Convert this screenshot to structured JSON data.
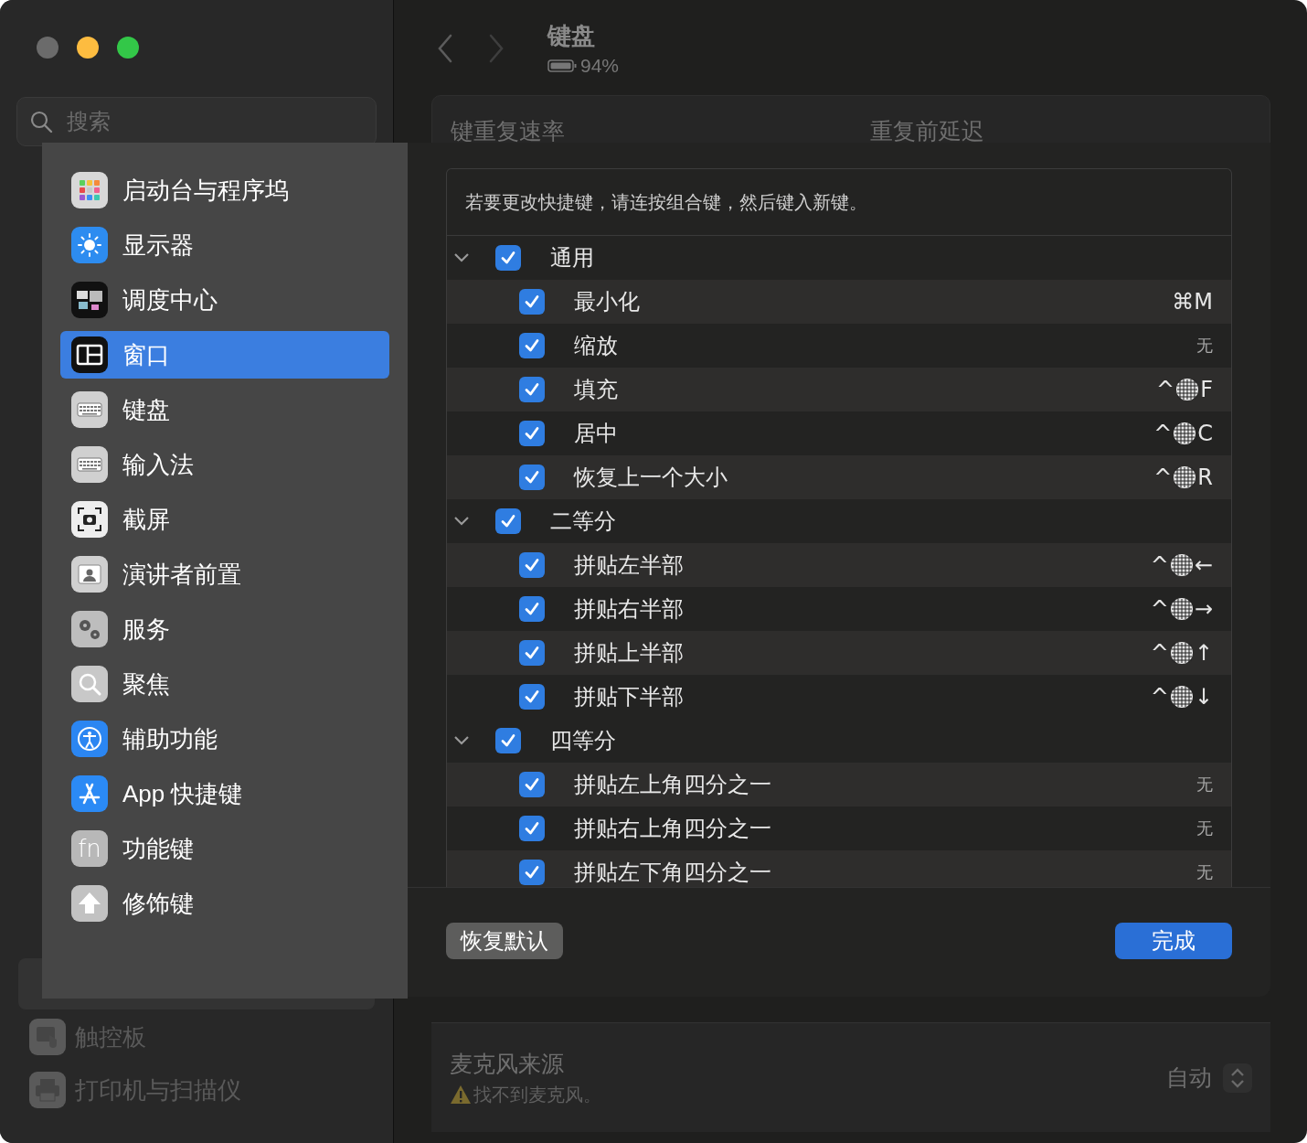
{
  "window": {
    "title": "键盘",
    "battery": "94%"
  },
  "sidebar": {
    "search": {
      "placeholder": "搜索"
    },
    "items": [
      {
        "label": "触控板"
      },
      {
        "label": "打印机与扫描仪"
      }
    ]
  },
  "settings": {
    "key_repeat_label": "键重复速率",
    "delay_label": "重复前延迟",
    "mic_label": "麦克风来源",
    "mic_warning": "找不到麦克风。",
    "mic_value": "自动"
  },
  "menu": {
    "items": [
      {
        "label": "启动台与程序坞",
        "selected": false
      },
      {
        "label": "显示器",
        "selected": false
      },
      {
        "label": "调度中心",
        "selected": false
      },
      {
        "label": "窗口",
        "selected": true
      },
      {
        "label": "键盘",
        "selected": false
      },
      {
        "label": "输入法",
        "selected": false
      },
      {
        "label": "截屏",
        "selected": false
      },
      {
        "label": "演讲者前置",
        "selected": false
      },
      {
        "label": "服务",
        "selected": false
      },
      {
        "label": "聚焦",
        "selected": false
      },
      {
        "label": "辅助功能",
        "selected": false
      },
      {
        "label": "App 快捷键",
        "selected": false
      },
      {
        "label": "功能键",
        "icon_text": "fn",
        "selected": false
      },
      {
        "label": "修饰键",
        "selected": false
      }
    ]
  },
  "sheet": {
    "hint": "若要更改快捷键，请连按组合键，然后键入新键。",
    "groups": [
      {
        "label": "通用",
        "checked": true,
        "expanded": true,
        "children": [
          {
            "label": "最小化",
            "checked": true,
            "shortcut": {
              "kind": "keys",
              "text": "⌘M"
            }
          },
          {
            "label": "缩放",
            "checked": true,
            "shortcut": {
              "kind": "none",
              "text": "无"
            }
          },
          {
            "label": "填充",
            "checked": true,
            "shortcut": {
              "kind": "globe",
              "before": "^",
              "after": "F"
            }
          },
          {
            "label": "居中",
            "checked": true,
            "shortcut": {
              "kind": "globe",
              "before": "^",
              "after": "C"
            }
          },
          {
            "label": "恢复上一个大小",
            "checked": true,
            "shortcut": {
              "kind": "globe",
              "before": "^",
              "after": "R"
            }
          }
        ]
      },
      {
        "label": "二等分",
        "checked": true,
        "expanded": true,
        "children": [
          {
            "label": "拼贴左半部",
            "checked": true,
            "shortcut": {
              "kind": "globe",
              "before": "^",
              "after": "←"
            }
          },
          {
            "label": "拼贴右半部",
            "checked": true,
            "shortcut": {
              "kind": "globe",
              "before": "^",
              "after": "→"
            }
          },
          {
            "label": "拼贴上半部",
            "checked": true,
            "shortcut": {
              "kind": "globe",
              "before": "^",
              "after": "↑"
            }
          },
          {
            "label": "拼贴下半部",
            "checked": true,
            "shortcut": {
              "kind": "globe",
              "before": "^",
              "after": "↓"
            }
          }
        ]
      },
      {
        "label": "四等分",
        "checked": true,
        "expanded": true,
        "children": [
          {
            "label": "拼贴左上角四分之一",
            "checked": true,
            "shortcut": {
              "kind": "none",
              "text": "无"
            }
          },
          {
            "label": "拼贴右上角四分之一",
            "checked": true,
            "shortcut": {
              "kind": "none",
              "text": "无"
            }
          },
          {
            "label": "拼贴左下角四分之一",
            "checked": true,
            "shortcut": {
              "kind": "none",
              "text": "无"
            }
          }
        ]
      }
    ],
    "buttons": {
      "restore": "恢复默认",
      "done": "完成"
    }
  }
}
